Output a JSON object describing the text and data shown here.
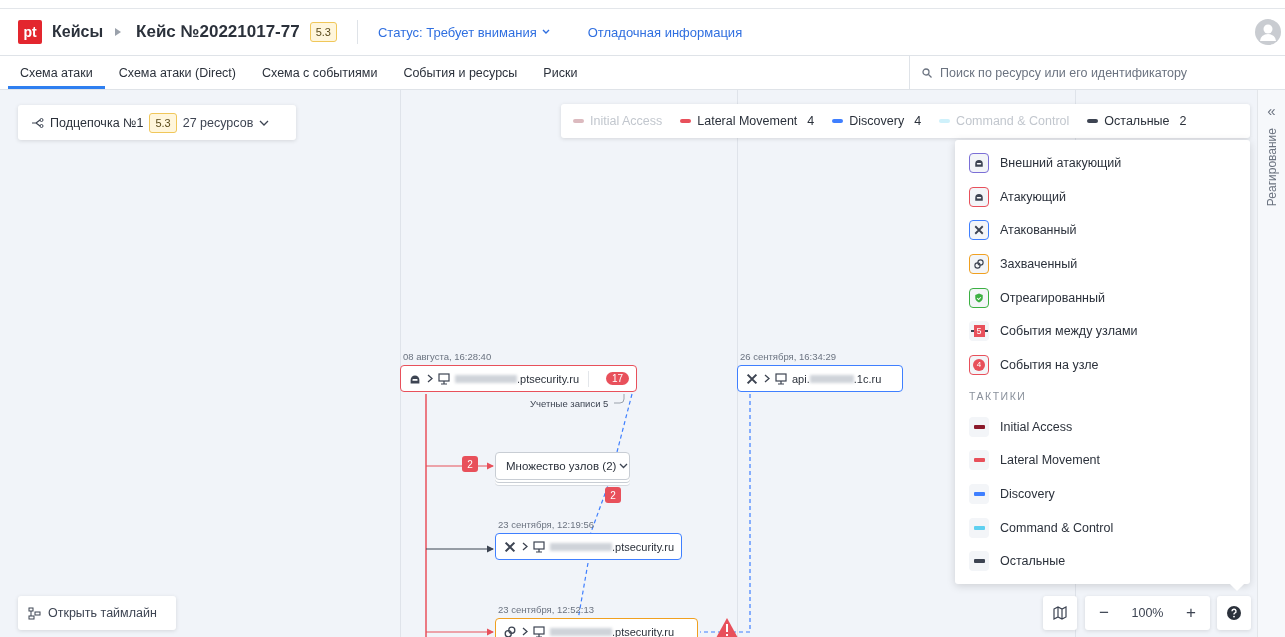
{
  "header": {
    "logo": "pt",
    "breadcrumb": "Кейсы",
    "case_title": "Кейс №20221017-77",
    "score": "5.3",
    "status": "Статус: Требует внимания",
    "debug_link": "Отладочная информация"
  },
  "tabs": [
    {
      "label": "Схема атаки",
      "selected": true
    },
    {
      "label": "Схема атаки (Direct)",
      "selected": false
    },
    {
      "label": "Схема с событиями",
      "selected": false
    },
    {
      "label": "События и ресурсы",
      "selected": false
    },
    {
      "label": "Риски",
      "selected": false
    }
  ],
  "search": {
    "placeholder": "Поиск по ресурсу или его идентификатору"
  },
  "chain": {
    "label": "Подцепочка №1",
    "score": "5.3",
    "resources": "27 ресурсов"
  },
  "tactics_bar": [
    {
      "label": "Initial Access",
      "enabled": false
    },
    {
      "label": "Lateral Movement",
      "enabled": true,
      "count": "4"
    },
    {
      "label": "Discovery",
      "enabled": true,
      "count": "4"
    },
    {
      "label": "Command & Control",
      "enabled": false
    },
    {
      "label": "Остальные",
      "enabled": true,
      "count": "2"
    }
  ],
  "nodes": [
    {
      "kind": "attacker",
      "time": "08 августа, 16:28:40",
      "suffix": ".ptsecurity.ru",
      "events": "17"
    },
    {
      "kind": "attacked",
      "time": "26 сентября, 16:34:29",
      "prefix": "api.",
      "suffix": ".1c.ru"
    },
    {
      "kind": "group",
      "label": "Множество узлов (2)"
    },
    {
      "kind": "attacked",
      "time": "23 сентября, 12:19:56",
      "suffix": ".ptsecurity.ru"
    },
    {
      "kind": "captured",
      "time": "23 сентября, 12:52:13",
      "suffix": ".ptsecurity.ru"
    }
  ],
  "edge_note": "Учетные записи 5",
  "edge_badges": [
    "2",
    "2"
  ],
  "legend": {
    "items": [
      {
        "kind": "external",
        "label": "Внешний атакующий"
      },
      {
        "kind": "attacker",
        "label": "Атакующий"
      },
      {
        "kind": "attacked",
        "label": "Атакованный"
      },
      {
        "kind": "captured",
        "label": "Захваченный"
      },
      {
        "kind": "responded",
        "label": "Отреагированный"
      },
      {
        "kind": "edge-events",
        "label": "События между узлами",
        "badge": "5"
      },
      {
        "kind": "node-events",
        "label": "События на узле",
        "badge": "4"
      }
    ],
    "section": "ТАКТИКИ",
    "tactics": [
      {
        "label": "Initial Access",
        "color": "#8b1a2b"
      },
      {
        "label": "Lateral Movement",
        "color": "#e8505b"
      },
      {
        "label": "Discovery",
        "color": "#3f7fff"
      },
      {
        "label": "Command & Control",
        "color": "#5fd0f0"
      },
      {
        "label": "Остальные",
        "color": "#3d4452"
      }
    ]
  },
  "zoom": {
    "out": "−",
    "value": "100%",
    "in": "+"
  },
  "timeline_button": "Открыть таймлайн",
  "side_panel": {
    "collapse": "«",
    "label": "Реагирование"
  }
}
